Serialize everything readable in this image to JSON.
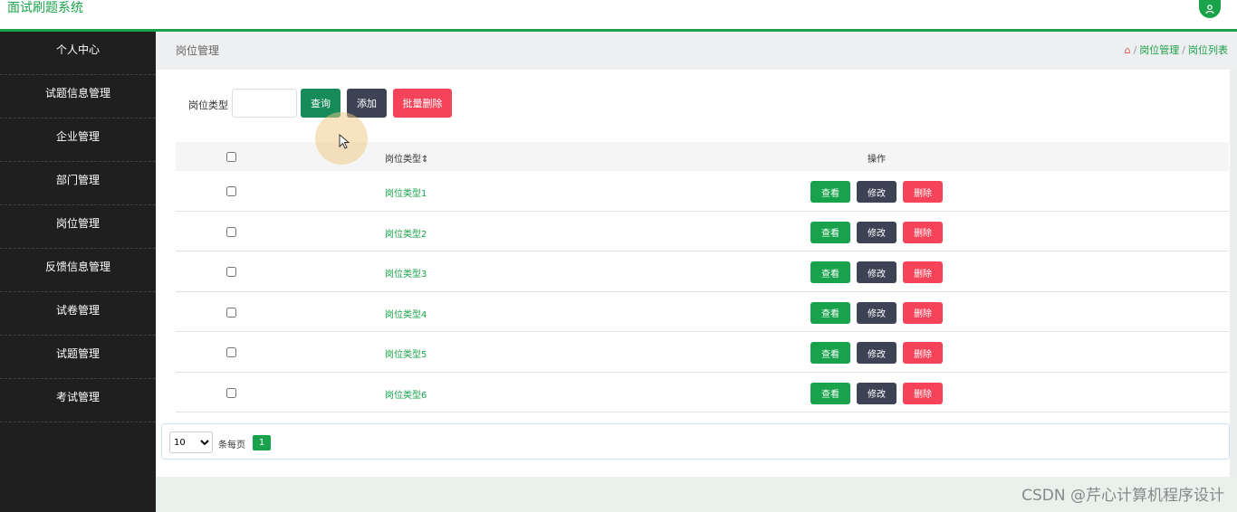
{
  "app": {
    "title": "面试刷题系统"
  },
  "header": {
    "user_icon": "user-icon"
  },
  "sidebar": {
    "items": [
      {
        "label": "个人中心"
      },
      {
        "label": "试题信息管理"
      },
      {
        "label": "企业管理"
      },
      {
        "label": "部门管理"
      },
      {
        "label": "岗位管理"
      },
      {
        "label": "反馈信息管理"
      },
      {
        "label": "试卷管理"
      },
      {
        "label": "试题管理"
      },
      {
        "label": "考试管理"
      }
    ]
  },
  "page": {
    "title": "岗位管理"
  },
  "breadcrumb": {
    "home_icon": "home-icon",
    "sep": "/",
    "items": [
      "岗位管理",
      "岗位列表"
    ]
  },
  "search": {
    "label": "岗位类型",
    "value": "",
    "query_label": "查询",
    "add_label": "添加",
    "batch_delete_label": "批量删除"
  },
  "table": {
    "headers": {
      "type": "岗位类型",
      "sort_icon": "sort-icon",
      "action": "操作"
    },
    "rows": [
      {
        "type": "岗位类型1"
      },
      {
        "type": "岗位类型2"
      },
      {
        "type": "岗位类型3"
      },
      {
        "type": "岗位类型4"
      },
      {
        "type": "岗位类型5"
      },
      {
        "type": "岗位类型6"
      }
    ],
    "actions": {
      "view": "查看",
      "edit": "修改",
      "delete": "删除"
    }
  },
  "pager": {
    "page_size": "10",
    "per_page_label": "条每页",
    "current_page": "1"
  },
  "watermark": "CSDN @芹心计算机程序设计",
  "colors": {
    "primary": "#1aa34a",
    "dark": "#3d4255",
    "danger": "#f5435a",
    "sidebar": "#1f1f1f"
  }
}
